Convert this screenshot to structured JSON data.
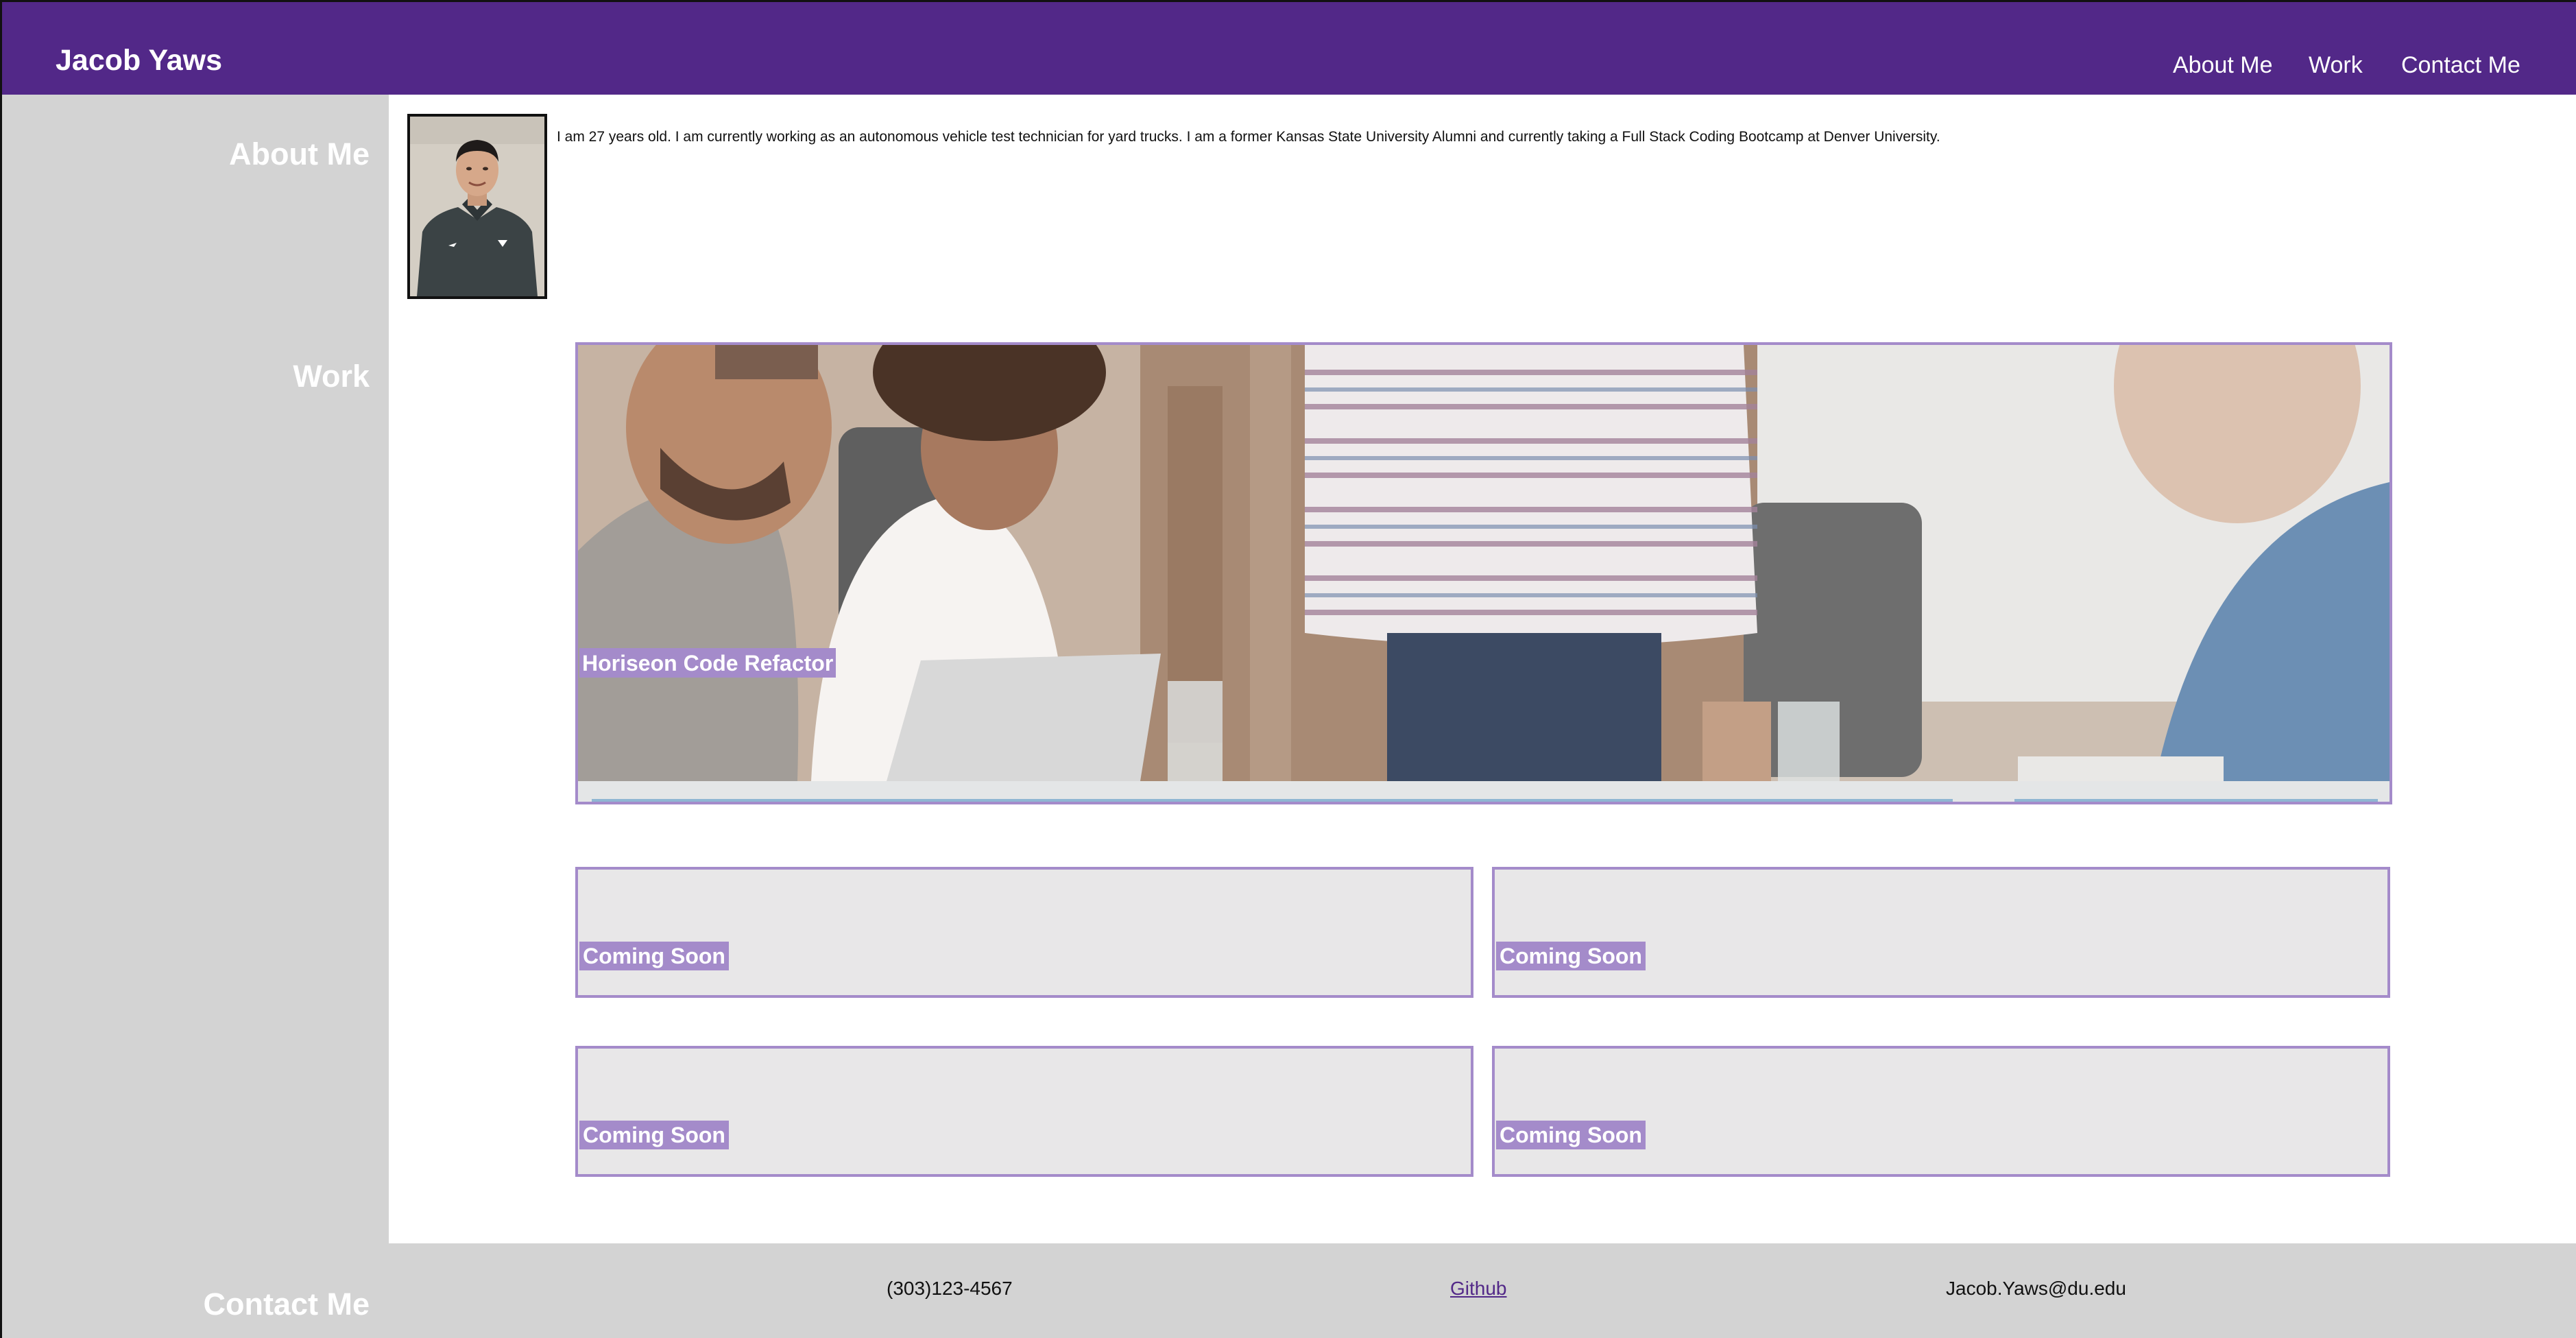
{
  "header": {
    "brand": "Jacob Yaws",
    "nav": [
      {
        "label": "About Me"
      },
      {
        "label": "Work"
      },
      {
        "label": "Contact Me"
      }
    ]
  },
  "sections": {
    "about_title": "About Me",
    "work_title": "Work",
    "contact_title": "Contact Me"
  },
  "about": {
    "text": "I am 27 years old. I am currently working as an autonomous vehicle test technician for yard trucks. I am a former Kansas State University Alumni and currently taking a Full Stack Coding Bootcamp at Denver University.",
    "portrait_icon": "person-portrait"
  },
  "work": {
    "featured": {
      "label": "Horiseon Code Refactor",
      "image_icon": "team-meeting-photo"
    },
    "projects": [
      {
        "label": "Coming Soon"
      },
      {
        "label": "Coming Soon"
      },
      {
        "label": "Coming Soon"
      },
      {
        "label": "Coming Soon"
      }
    ]
  },
  "contact": {
    "phone": "(303)123-4567",
    "github": "Github",
    "email": "Jacob.Yaws@du.edu"
  },
  "colors": {
    "brand_purple": "#522888",
    "accent_lavender": "#a48bca",
    "sidebar_gray": "#d3d3d3"
  }
}
